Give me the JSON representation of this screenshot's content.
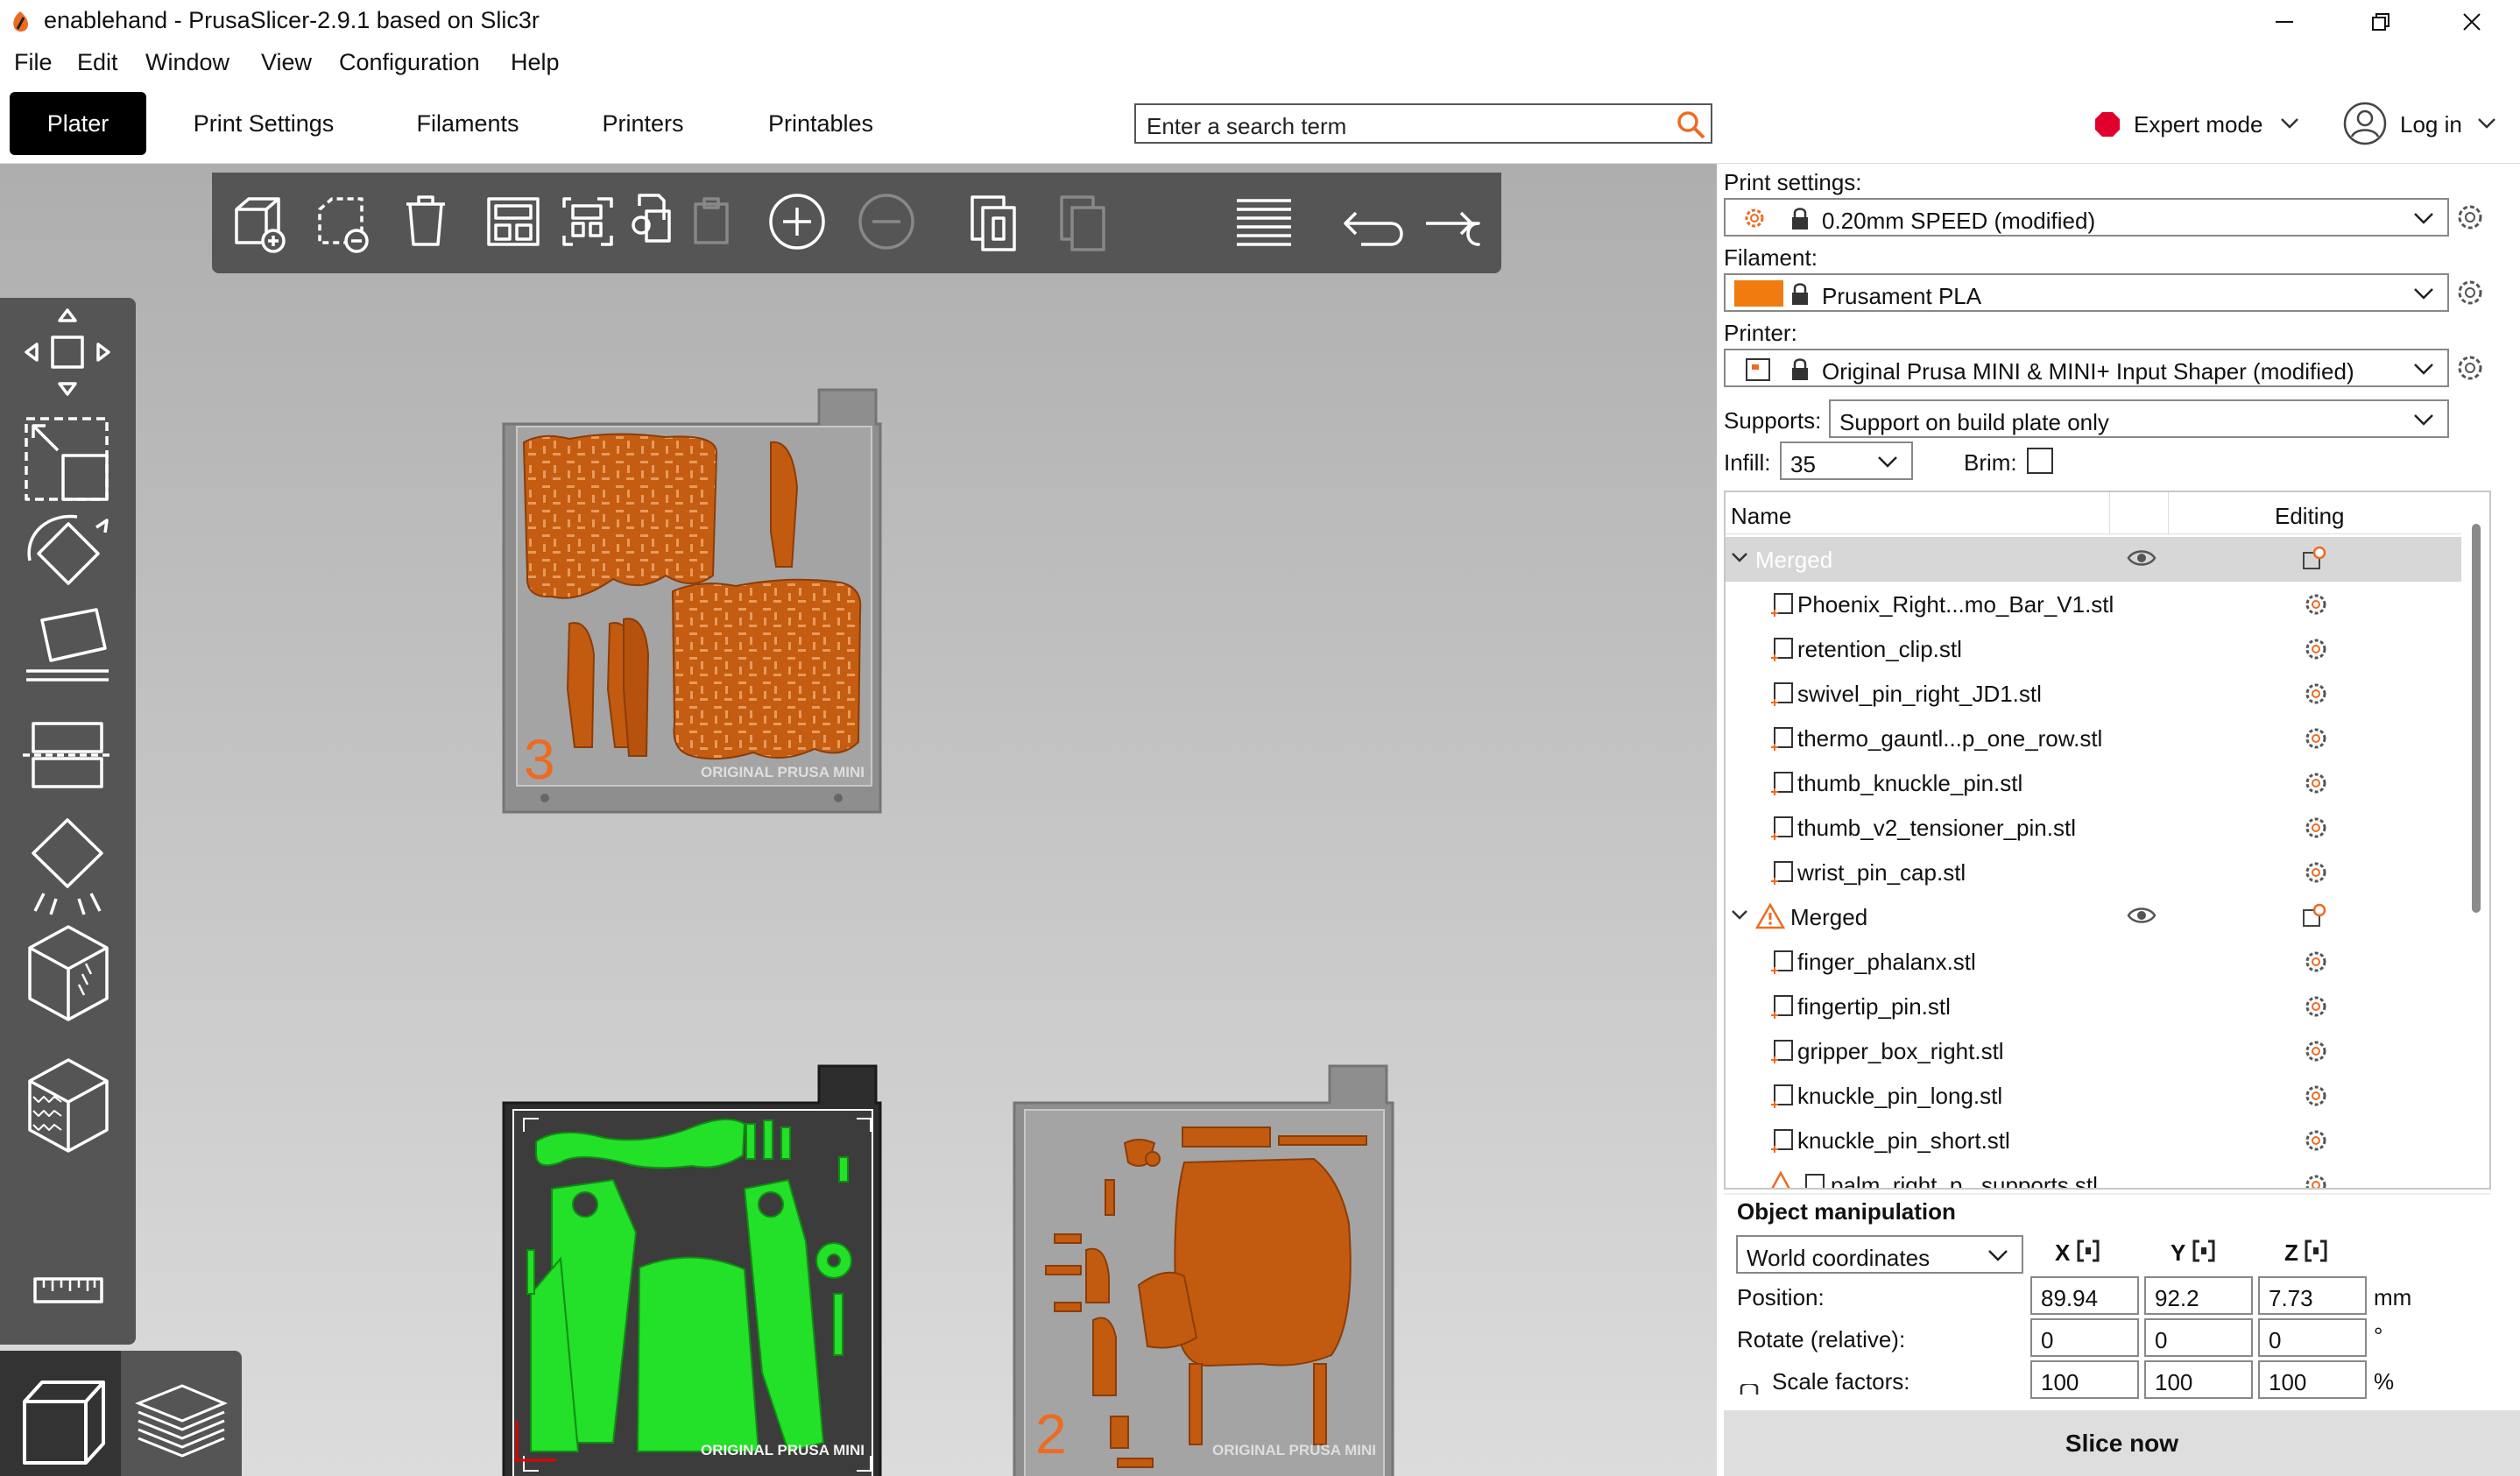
{
  "window": {
    "title": "enablehand - PrusaSlicer-2.9.1 based on Slic3r",
    "buttons": [
      "minimize",
      "maximize",
      "close"
    ]
  },
  "menu": [
    "File",
    "Edit",
    "Window",
    "View",
    "Configuration",
    "Help"
  ],
  "tabs": [
    "Plater",
    "Print Settings",
    "Filaments",
    "Printers",
    "Printables"
  ],
  "active_tab": "Plater",
  "search": {
    "placeholder": "Enter a search term"
  },
  "mode": {
    "label": "Expert mode",
    "color": "#e0002b"
  },
  "login": {
    "label": "Log in"
  },
  "toolbar": {
    "icons": [
      "add-icon",
      "delete-icon",
      "delete-all-icon",
      "arrange-icon",
      "arrange-selection-icon",
      "copy-icon",
      "paste-icon",
      "add-instance-icon",
      "remove-instance-icon",
      "split-to-objects-icon",
      "split-to-parts-icon",
      "layers-editing-icon",
      "undo-icon",
      "redo-icon"
    ],
    "disabled": [
      "paste-icon",
      "remove-instance-icon",
      "split-to-parts-icon"
    ]
  },
  "left_tools": [
    "move-icon",
    "scale-icon",
    "rotate-icon",
    "place-on-face-icon",
    "cut-icon",
    "supports-painting-icon",
    "seam-painting-icon",
    "fuzzy-skin-icon",
    "measure-icon"
  ],
  "views": [
    "3d-view-icon",
    "preview-icon"
  ],
  "beds": [
    {
      "number": "3",
      "label": "ORIGINAL PRUSA MINI",
      "active": false
    },
    {
      "number": "",
      "label": "ORIGINAL PRUSA MINI",
      "active": true
    },
    {
      "number": "2",
      "label": "ORIGINAL PRUSA MINI",
      "active": false
    }
  ],
  "colors": {
    "accent": "#ed6b21",
    "selected_part": "#23e028",
    "part": "#c75c0f"
  },
  "sidebar": {
    "print_settings_label": "Print settings:",
    "print_settings_value": "0.20mm SPEED (modified)",
    "filament_label": "Filament:",
    "filament_value": "Prusament PLA",
    "filament_color": "#f07b0e",
    "printer_label": "Printer:",
    "printer_value": "Original Prusa MINI & MINI+ Input Shaper (modified)",
    "supports_label": "Supports:",
    "supports_value": "Support on build plate only",
    "infill_label": "Infill:",
    "infill_value": "35",
    "brim_label": "Brim:",
    "brim_checked": false
  },
  "object_list": {
    "col_name": "Name",
    "col_editing": "Editing",
    "rows": [
      {
        "name": "Merged",
        "type": "group",
        "greyed": true,
        "warning": false
      },
      {
        "name": "Phoenix_Right...mo_Bar_V1.stl",
        "type": "part"
      },
      {
        "name": "retention_clip.stl",
        "type": "part"
      },
      {
        "name": "swivel_pin_right_JD1.stl",
        "type": "part"
      },
      {
        "name": "thermo_gauntl...p_one_row.stl",
        "type": "part"
      },
      {
        "name": "thumb_knuckle_pin.stl",
        "type": "part"
      },
      {
        "name": "thumb_v2_tensioner_pin.stl",
        "type": "part"
      },
      {
        "name": "wrist_pin_cap.stl",
        "type": "part"
      },
      {
        "name": "Merged",
        "type": "group",
        "greyed": false,
        "warning": true
      },
      {
        "name": "finger_phalanx.stl",
        "type": "part"
      },
      {
        "name": "fingertip_pin.stl",
        "type": "part"
      },
      {
        "name": "gripper_box_right.stl",
        "type": "part"
      },
      {
        "name": "knuckle_pin_long.stl",
        "type": "part"
      },
      {
        "name": "knuckle_pin_short.stl",
        "type": "part"
      },
      {
        "name": "palm_right_p...supports.stl",
        "type": "part",
        "warning": true
      }
    ]
  },
  "manipulation": {
    "title": "Object manipulation",
    "coordinates": "World coordinates",
    "axes": [
      "X",
      "Y",
      "Z"
    ],
    "position_label": "Position:",
    "position": [
      "89.94",
      "92.2",
      "7.73"
    ],
    "position_unit": "mm",
    "rotate_label": "Rotate (relative):",
    "rotate": [
      "0",
      "0",
      "0"
    ],
    "rotate_unit": "°",
    "scale_label": "Scale factors:",
    "scale": [
      "100",
      "100",
      "100"
    ],
    "scale_unit": "%"
  },
  "slice_button": "Slice now"
}
